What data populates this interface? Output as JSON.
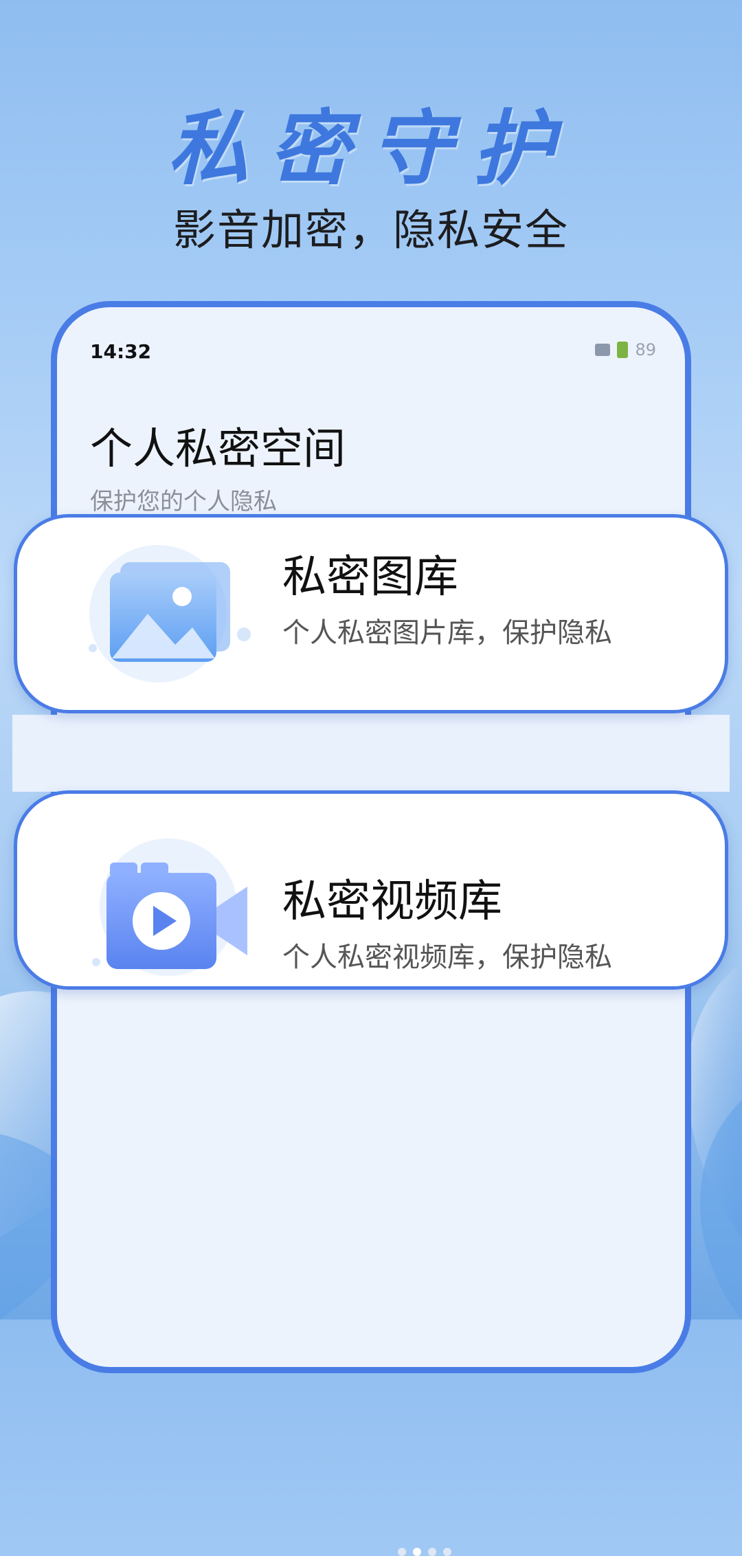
{
  "promo": {
    "title": "私密守护",
    "subtitle": "影音加密，隐私安全"
  },
  "status_bar": {
    "time": "14:32",
    "battery": "89"
  },
  "header": {
    "title": "个人私密空间",
    "subtitle": "保护您的个人隐私"
  },
  "cards": [
    {
      "title": "私密图库",
      "description": "个人私密图片库，保护隐私",
      "icon": "image-gallery-icon"
    },
    {
      "title": "私密视频库",
      "description": "个人私密视频库，保护隐私",
      "icon": "video-camera-icon"
    }
  ],
  "pagination": {
    "total": 4,
    "active": 2
  },
  "colors": {
    "accent": "#4a7ce6",
    "title_blue": "#3e78de",
    "phone_bg": "#edf3fd"
  }
}
